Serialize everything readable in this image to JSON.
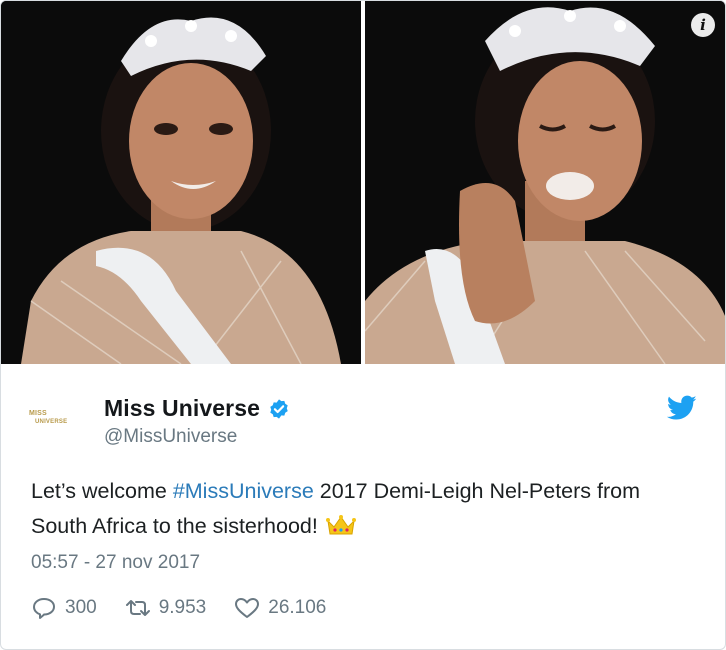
{
  "media": {
    "left_photo_alt": "",
    "right_photo_alt": "",
    "info_icon_glyph": "i"
  },
  "account": {
    "display_name": "Miss Universe",
    "handle": "@MissUniverse",
    "avatar_logo_line1": "MISS",
    "avatar_logo_line2": "UNIVERSE",
    "verified": true
  },
  "tweet": {
    "text_before": "Let’s welcome ",
    "hashtag": "#MissUniverse",
    "text_after": " 2017 Demi-Leigh Nel-Peters from South Africa to the sisterhood!",
    "emoji": "crown",
    "timestamp": "05:57 - 27 nov 2017"
  },
  "actions": {
    "replies": "300",
    "retweets": "9.953",
    "likes": "26.106"
  },
  "colors": {
    "hashtag": "#2b7bb9",
    "twitter_blue": "#1da1f2",
    "muted": "#697882"
  }
}
